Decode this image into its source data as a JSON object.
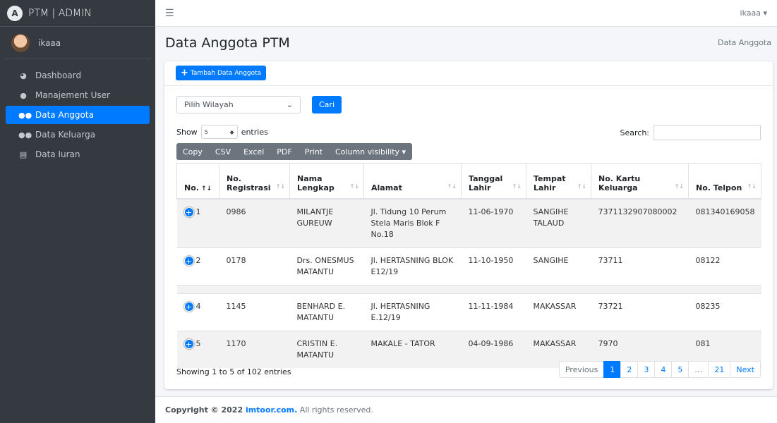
{
  "app": {
    "brand": "PTM | ADMIN",
    "user_top": "ikaaa ▾",
    "user_sidebar": "ikaaa"
  },
  "sidebar": {
    "items": [
      {
        "label": "Dashboard",
        "icon": "dashboard-icon",
        "active": false
      },
      {
        "label": "Manajement User",
        "icon": "user-icon",
        "active": false
      },
      {
        "label": "Data Anggota",
        "icon": "users-icon",
        "active": true
      },
      {
        "label": "Data Keluarga",
        "icon": "users-icon",
        "active": false
      },
      {
        "label": "Data Iuran",
        "icon": "card-icon",
        "active": false
      }
    ]
  },
  "page": {
    "title": "Data Anggota PTM",
    "breadcrumb": "Data Anggota"
  },
  "card": {
    "add_button": "Tambah Data Anggota",
    "filter": {
      "select_value": "Pilih Wilayah",
      "button": "Cari"
    },
    "length": {
      "show": "Show",
      "value": "5",
      "entries": "entries"
    },
    "search": {
      "label": "Search:"
    },
    "export_buttons": [
      "Copy",
      "CSV",
      "Excel",
      "PDF",
      "Print",
      "Column visibility ▾"
    ]
  },
  "table": {
    "columns": [
      "No.",
      "No. Registrasi",
      "Nama Lengkap",
      "Alamat",
      "Tanggal Lahir",
      "Tempat Lahir",
      "No. Kartu Keluarga",
      "No. Telpon"
    ],
    "rows": [
      {
        "no": "1",
        "reg": "0986",
        "nama": "MILANTJE GUREUW",
        "alamat": "Jl. Tidung 10 Perum Stela Maris Blok F No.18",
        "tgl": "11-06-1970",
        "tempat": "SANGIHE TALAUD",
        "kk": "7371132907080002",
        "telp": "081340169058"
      },
      {
        "no": "2",
        "reg": "0178",
        "nama": "Drs. ONESMUS MATANTU",
        "alamat": "Jl. HERTASNING BLOK E12/19",
        "tgl": "11-10-1950",
        "tempat": "SANGIHE",
        "kk": "73711",
        "telp": "08122"
      },
      {
        "no": "4",
        "reg": "1145",
        "nama": "BENHARD E. MATANTU",
        "alamat": "Jl. HERTASNING E.12/19",
        "tgl": "11-11-1984",
        "tempat": "MAKASSAR",
        "kk": "73721",
        "telp": "08235"
      },
      {
        "no": "5",
        "reg": "1170",
        "nama": "CRISTIN E. MATANTU",
        "alamat": "MAKALE - TATOR",
        "tgl": "04-09-1986",
        "tempat": "MAKASSAR",
        "kk": "7970",
        "telp": "081"
      }
    ]
  },
  "footer_info": "Showing 1 to 5 of 102 entries",
  "pagination": [
    "Previous",
    "1",
    "2",
    "3",
    "4",
    "5",
    "…",
    "21",
    "Next"
  ],
  "footer": {
    "prefix": "Copyright © 2022 ",
    "link": "imtoor.com.",
    "suffix": " All rights reserved."
  }
}
